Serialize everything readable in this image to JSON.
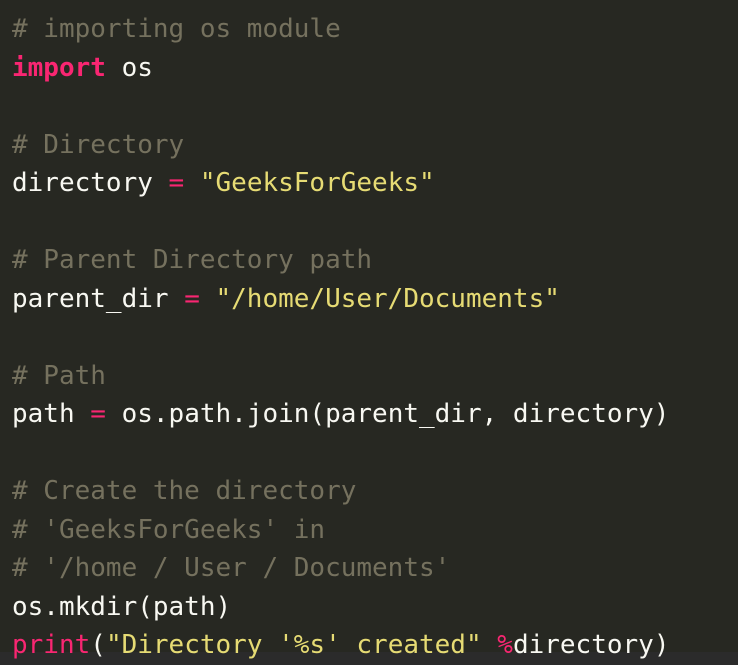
{
  "code_block": {
    "language": "python",
    "background": "#272822",
    "colors": {
      "comment": "#75715e",
      "keyword": "#f92672",
      "operator": "#f92672",
      "string": "#e6db74",
      "builtin": "#f92672",
      "plain": "#f8f8f2"
    },
    "lines": [
      [
        {
          "t": "comment",
          "v": "# importing os module"
        }
      ],
      [
        {
          "t": "keyword",
          "v": "import"
        },
        {
          "t": "plain",
          "v": " os"
        }
      ],
      [],
      [
        {
          "t": "comment",
          "v": "# Directory"
        }
      ],
      [
        {
          "t": "plain",
          "v": "directory "
        },
        {
          "t": "operator",
          "v": "="
        },
        {
          "t": "plain",
          "v": " "
        },
        {
          "t": "string",
          "v": "\"GeeksForGeeks\""
        }
      ],
      [],
      [
        {
          "t": "comment",
          "v": "# Parent Directory path"
        }
      ],
      [
        {
          "t": "plain",
          "v": "parent_dir "
        },
        {
          "t": "operator",
          "v": "="
        },
        {
          "t": "plain",
          "v": " "
        },
        {
          "t": "string",
          "v": "\"/home/User/Documents\""
        }
      ],
      [],
      [
        {
          "t": "comment",
          "v": "# Path"
        }
      ],
      [
        {
          "t": "plain",
          "v": "path "
        },
        {
          "t": "operator",
          "v": "="
        },
        {
          "t": "plain",
          "v": " os.path.join(parent_dir, directory)"
        }
      ],
      [],
      [
        {
          "t": "comment",
          "v": "# Create the directory"
        }
      ],
      [
        {
          "t": "comment",
          "v": "# 'GeeksForGeeks' in"
        }
      ],
      [
        {
          "t": "comment",
          "v": "# '/home / User / Documents'"
        }
      ],
      [
        {
          "t": "plain",
          "v": "os.mkdir(path)"
        }
      ],
      [
        {
          "t": "builtin",
          "v": "print"
        },
        {
          "t": "plain",
          "v": "("
        },
        {
          "t": "string",
          "v": "\"Directory '%s' created\""
        },
        {
          "t": "plain",
          "v": " "
        },
        {
          "t": "operator",
          "v": "%"
        },
        {
          "t": "plain",
          "v": "directory)"
        }
      ]
    ]
  }
}
